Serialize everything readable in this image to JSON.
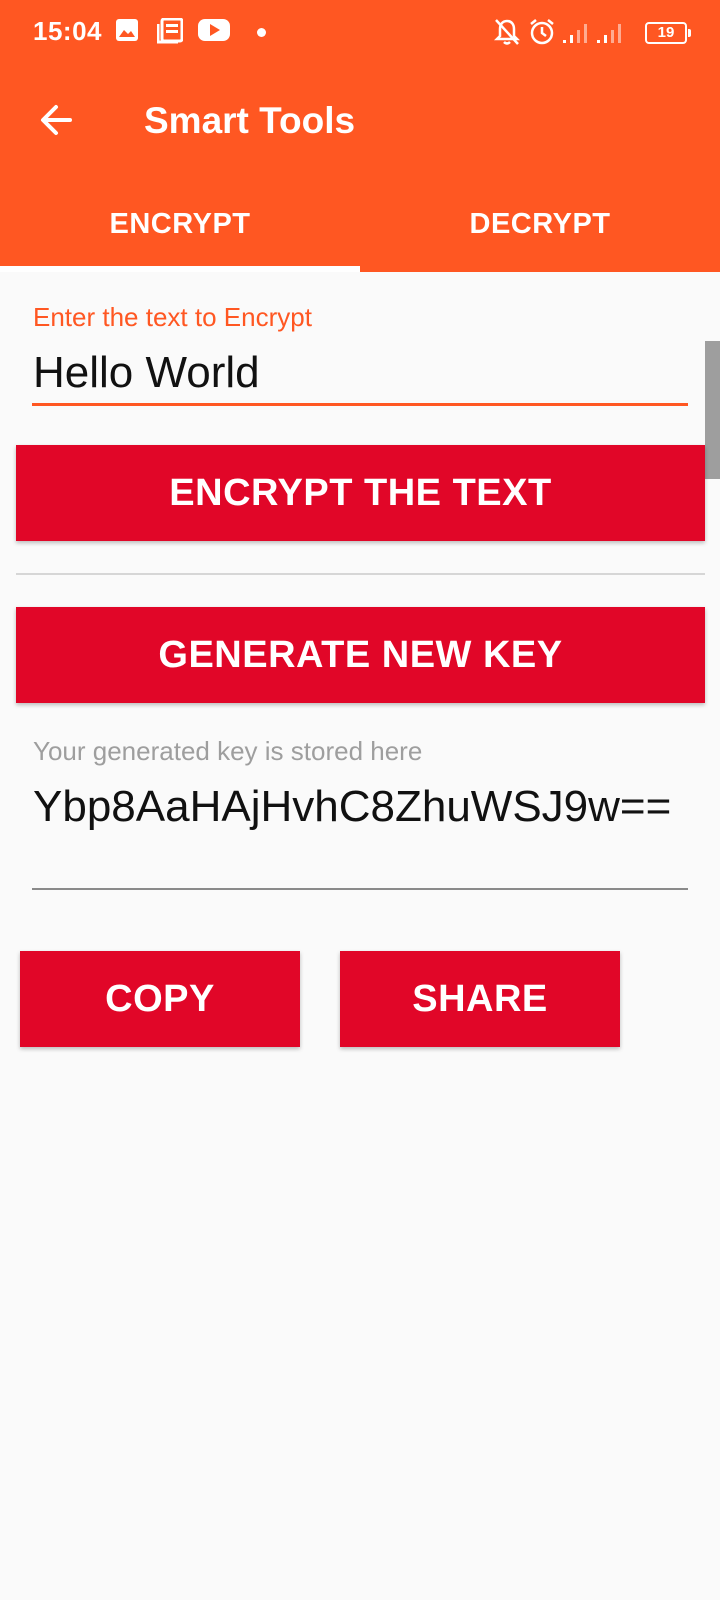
{
  "status_bar": {
    "time": "15:04",
    "battery": "19",
    "left_icons": [
      "gallery-icon",
      "news-icon",
      "youtube-icon"
    ],
    "right_icons": [
      "bell-off-icon",
      "alarm-icon",
      "signal-icon",
      "signal-icon",
      "battery-icon"
    ]
  },
  "toolbar": {
    "title": "Smart Tools",
    "back_icon": "arrow-left-icon"
  },
  "tabs": [
    {
      "label": "ENCRYPT",
      "selected": true
    },
    {
      "label": "DECRYPT",
      "selected": false
    }
  ],
  "encrypt_form": {
    "input_label": "Enter the text to Encrypt",
    "input_value": "Hello World",
    "encrypt_button": "ENCRYPT THE TEXT",
    "generate_button": "GENERATE NEW KEY",
    "key_label": "Your generated key is stored here",
    "key_value": "Ybp8AaHAjHvhC8ZhuWSJ9w==",
    "copy_button": "COPY",
    "share_button": "SHARE"
  },
  "colors": {
    "app_bar": "#ff5722",
    "accent": "#ff5722",
    "button": "#e10628"
  }
}
